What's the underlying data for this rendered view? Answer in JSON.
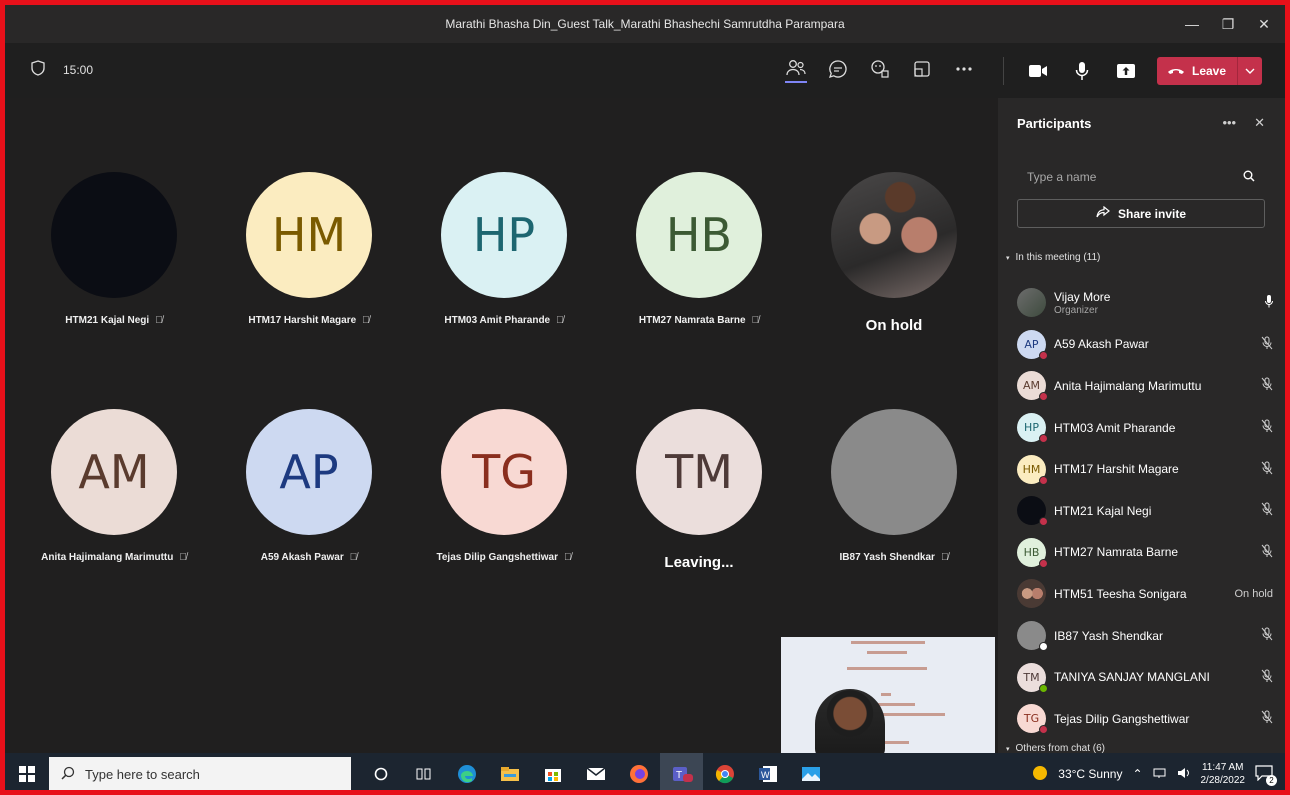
{
  "window": {
    "title": "Marathi Bhasha Din_Guest Talk_Marathi Bhashechi Samrutdha Parampara",
    "minimize": "—",
    "restore": "❐",
    "close": "✕"
  },
  "toolbar": {
    "timer": "15:00",
    "leave_label": "Leave"
  },
  "tiles": [
    {
      "initials": "",
      "name": "HTM21 Kajal Negi",
      "bg": "#0b0d14",
      "fg": "#ffffff"
    },
    {
      "initials": "HM",
      "name": "HTM17 Harshit Magare",
      "bg": "#fbecc0",
      "fg": "#7a5a00"
    },
    {
      "initials": "HP",
      "name": "HTM03 Amit Pharande",
      "bg": "#daf1f3",
      "fg": "#1d6670"
    },
    {
      "initials": "HB",
      "name": "HTM27 Namrata Barne",
      "bg": "#e0f0dc",
      "fg": "#3c5a34"
    },
    {
      "initials": "",
      "name": "",
      "status": "On hold",
      "bg": "#3a3838",
      "fg": "#ffffff"
    },
    {
      "initials": "AM",
      "name": "Anita Hajimalang Marimuttu",
      "bg": "#ebdcd6",
      "fg": "#5a3b2e"
    },
    {
      "initials": "AP",
      "name": "A59 Akash Pawar",
      "bg": "#cdd9f1",
      "fg": "#1d3a80"
    },
    {
      "initials": "TG",
      "name": "Tejas Dilip Gangshettiwar",
      "bg": "#f8d9d3",
      "fg": "#8a2e1e"
    },
    {
      "initials": "TM",
      "name": "",
      "status": "Leaving...",
      "bg": "#ebdedc",
      "fg": "#4e3a38"
    },
    {
      "initials": "",
      "name": "IB87 Yash Shendkar",
      "bg": "#8a8a8a",
      "fg": "#ffffff"
    }
  ],
  "participants": {
    "title": "Participants",
    "search_placeholder": "Type a name",
    "share_invite": "Share invite",
    "in_meeting": "In this meeting (11)",
    "others": "Others from chat (6)",
    "people": [
      {
        "initials": "",
        "name": "Vijay More",
        "role": "Organizer",
        "right": "🎙",
        "bg": "#6b6b6b",
        "fg": "#fff",
        "dot": ""
      },
      {
        "initials": "AP",
        "name": "A59 Akash Pawar",
        "right": "mic-off",
        "bg": "#cdd9f1",
        "fg": "#1d3a80",
        "dot": "red"
      },
      {
        "initials": "AM",
        "name": "Anita Hajimalang Marimuttu",
        "right": "mic-off",
        "bg": "#ebdcd6",
        "fg": "#5a3b2e",
        "dot": "red"
      },
      {
        "initials": "HP",
        "name": "HTM03 Amit Pharande",
        "right": "mic-off",
        "bg": "#daf1f3",
        "fg": "#1d6670",
        "dot": "red"
      },
      {
        "initials": "HM",
        "name": "HTM17 Harshit Magare",
        "right": "mic-off",
        "bg": "#fbecc0",
        "fg": "#7a5a00",
        "dot": "red"
      },
      {
        "initials": "",
        "name": "HTM21 Kajal Negi",
        "right": "mic-off",
        "bg": "#0b0d14",
        "fg": "#fff",
        "dot": "red"
      },
      {
        "initials": "HB",
        "name": "HTM27 Namrata Barne",
        "right": "mic-off",
        "bg": "#e0f0dc",
        "fg": "#3c5a34",
        "dot": "red"
      },
      {
        "initials": "",
        "name": "HTM51 Teesha Sonigara",
        "right": "On hold",
        "bg": "#8a6a5c",
        "fg": "#fff",
        "dot": ""
      },
      {
        "initials": "",
        "name": "IB87 Yash Shendkar",
        "right": "mic-off",
        "bg": "#8a8a8a",
        "fg": "#fff",
        "dot": "white"
      },
      {
        "initials": "TM",
        "name": "TANIYA SANJAY MANGLANI",
        "right": "mic-off",
        "bg": "#ebdedc",
        "fg": "#4e3a38",
        "dot": "green"
      },
      {
        "initials": "TG",
        "name": "Tejas Dilip Gangshettiwar",
        "right": "mic-off",
        "bg": "#f8d9d3",
        "fg": "#8a2e1e",
        "dot": "red"
      }
    ]
  },
  "taskbar": {
    "search_placeholder": "Type here to search",
    "weather": "33°C  Sunny",
    "time": "11:47 AM",
    "date": "2/28/2022",
    "notif_count": "2"
  }
}
